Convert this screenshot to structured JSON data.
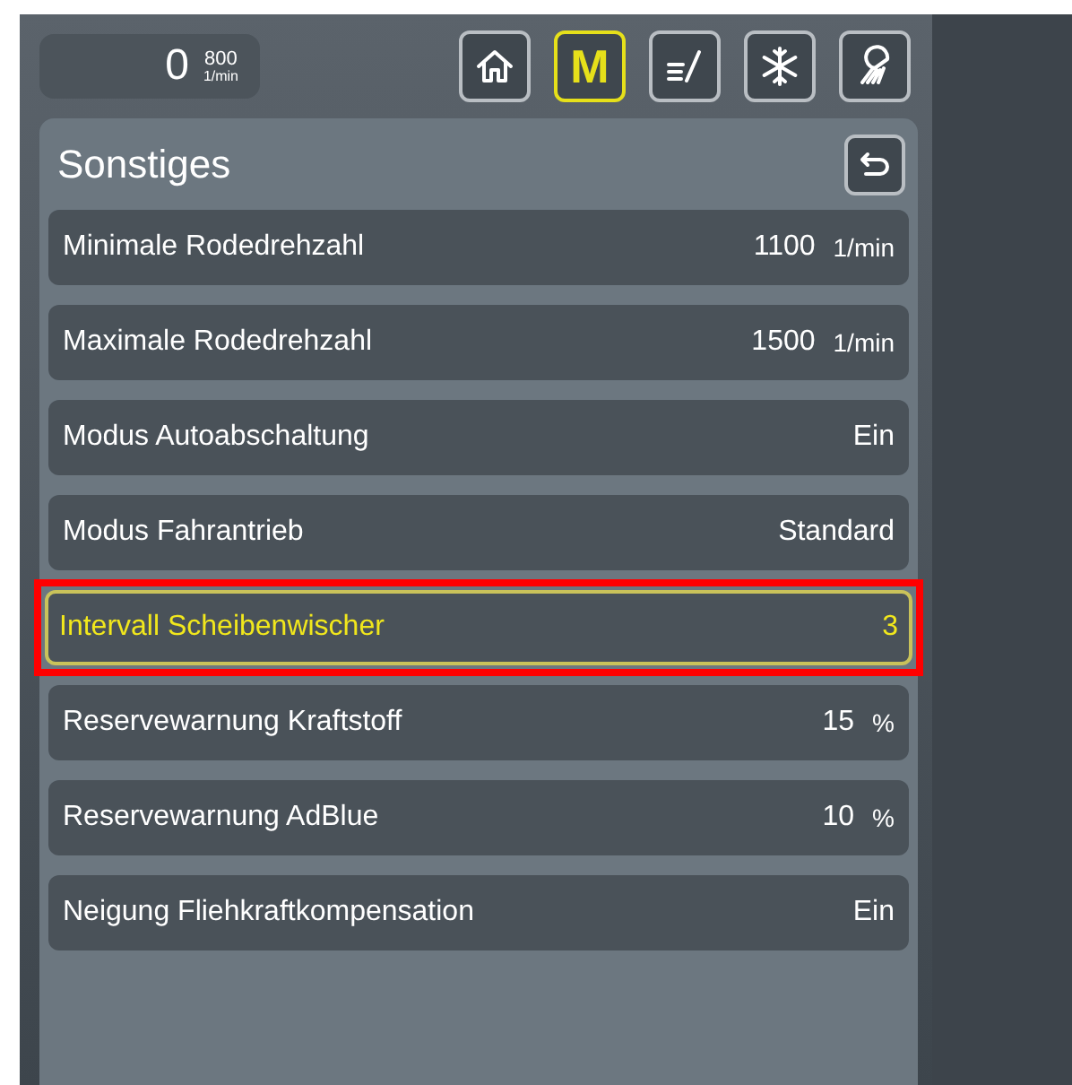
{
  "rpm": {
    "value": "0",
    "limit": "800",
    "unit": "1/min"
  },
  "nav": [
    {
      "kind": "home",
      "selected": false
    },
    {
      "kind": "letter",
      "label": "M",
      "selected": true
    },
    {
      "kind": "edit",
      "selected": false
    },
    {
      "kind": "snow",
      "selected": false
    },
    {
      "kind": "light",
      "selected": false
    }
  ],
  "title": "Sonstiges",
  "settings": [
    {
      "label": "Minimale Rodedrehzahl",
      "value": "1100",
      "unit": "1/min",
      "selected": false,
      "marked": false
    },
    {
      "label": "Maximale Rodedrehzahl",
      "value": "1500",
      "unit": "1/min",
      "selected": false,
      "marked": false
    },
    {
      "label": "Modus Autoabschaltung",
      "value": "Ein",
      "selected": false,
      "marked": false
    },
    {
      "label": "Modus Fahrantrieb",
      "value": "Standard",
      "selected": false,
      "marked": false
    },
    {
      "label": "Intervall Scheibenwischer",
      "value": "3",
      "selected": true,
      "marked": true
    },
    {
      "label": "Reservewarnung Kraftstoff",
      "value": "15",
      "unit": "%",
      "selected": false,
      "marked": false
    },
    {
      "label": "Reservewarnung AdBlue",
      "value": "10",
      "unit": "%",
      "selected": false,
      "marked": false
    },
    {
      "label": "Neigung Fliehkraftkompensation",
      "value": "Ein",
      "selected": false,
      "marked": false
    }
  ]
}
